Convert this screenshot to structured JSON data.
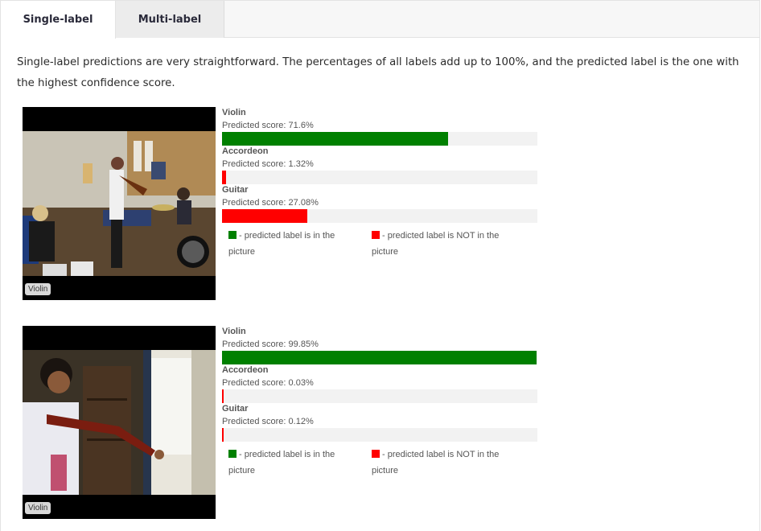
{
  "tabs": [
    {
      "label": "Single-label",
      "active": true
    },
    {
      "label": "Multi-label",
      "active": false
    }
  ],
  "intro_text": "Single-label predictions are very straightforward. The percentages of all labels add up to 100%, and the predicted label is the one with the highest confidence score.",
  "colors": {
    "in_picture": "#008000",
    "not_in_picture": "#ff0000",
    "track": "#f2f2f2"
  },
  "legend": {
    "in_picture": "- predicted label is in the picture",
    "not_in_picture": "- predicted label is NOT in the picture"
  },
  "examples": [
    {
      "image_label": "Violin",
      "predictions": [
        {
          "name": "Violin",
          "score_text": "Predicted score: 71.6%",
          "score": 71.6,
          "in_picture": true
        },
        {
          "name": "Accordeon",
          "score_text": "Predicted score: 1.32%",
          "score": 1.32,
          "in_picture": false
        },
        {
          "name": "Guitar",
          "score_text": "Predicted score: 27.08%",
          "score": 27.08,
          "in_picture": false
        }
      ]
    },
    {
      "image_label": "Violin",
      "predictions": [
        {
          "name": "Violin",
          "score_text": "Predicted score: 99.85%",
          "score": 99.85,
          "in_picture": true
        },
        {
          "name": "Accordeon",
          "score_text": "Predicted score: 0.03%",
          "score": 0.03,
          "in_picture": false
        },
        {
          "name": "Guitar",
          "score_text": "Predicted score: 0.12%",
          "score": 0.12,
          "in_picture": false
        }
      ]
    }
  ]
}
